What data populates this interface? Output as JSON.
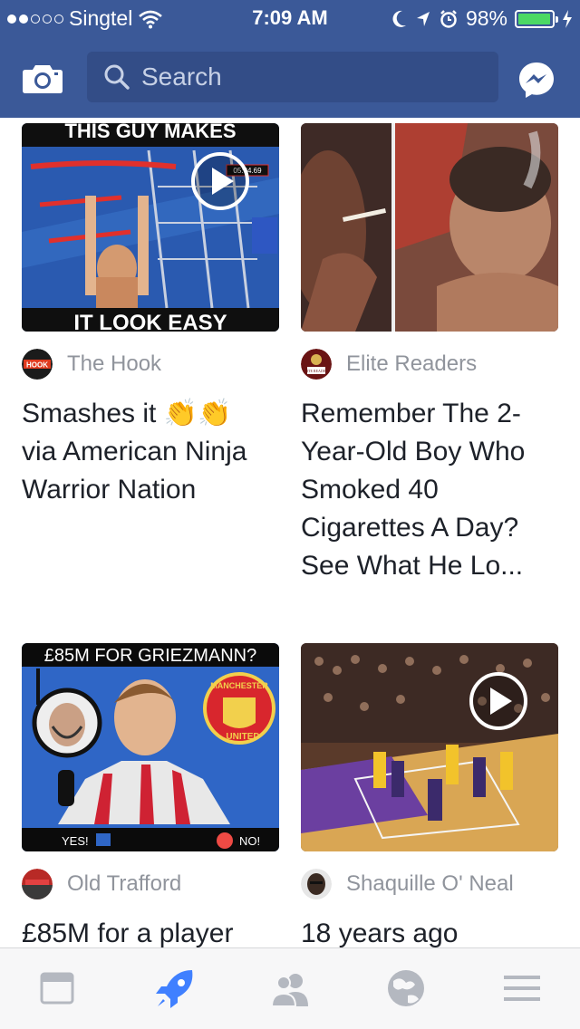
{
  "status": {
    "carrier": "Singtel",
    "time": "7:09 AM",
    "battery": "98%",
    "signal_bars": 2,
    "signal_total": 5,
    "battery_level": 0.98
  },
  "navbar": {
    "search_placeholder": "Search",
    "camera_icon": "camera-icon",
    "messenger_icon": "messenger-icon"
  },
  "cards": [
    {
      "thumb_text_top": "THIS GUY MAKES",
      "thumb_text_bottom": "IT LOOK EASY",
      "timer": "05:04.69",
      "source": "The Hook",
      "source_avatar_text": "HOOK",
      "title_line1": "Smashes it 👏👏",
      "title_line2": "via American Ninja",
      "title_line3": "Warrior Nation",
      "has_video": true
    },
    {
      "source": "Elite Readers",
      "source_avatar_text": "ELITE READERS",
      "title_line1": "Remember The 2-",
      "title_line2": "Year-Old Boy Who",
      "title_line3": "Smoked 40",
      "title_line4": "Cigarettes A Day?",
      "title_line5": "See What He Lo...",
      "has_video": false
    },
    {
      "thumb_text_top": "£85M FOR GRIEZMANN?",
      "yes_label": "YES!",
      "no_label": "NO!",
      "badge_text_top": "MANCHESTER",
      "badge_text_bottom": "UNITED",
      "source": "Old Trafford",
      "title_line1": "£85M for a player",
      "has_video": false
    },
    {
      "source": "Shaquille O' Neal",
      "title_line1": "18 years ago",
      "has_video": true
    }
  ],
  "tabs": [
    {
      "name": "news-feed-icon",
      "active": false
    },
    {
      "name": "explore-rocket-icon",
      "active": true
    },
    {
      "name": "friends-icon",
      "active": false
    },
    {
      "name": "globe-icon",
      "active": false
    },
    {
      "name": "menu-icon",
      "active": false
    }
  ],
  "colors": {
    "brand": "#3b5998",
    "active_tab": "#4080ff",
    "inactive_tab": "#b4b8c0",
    "battery": "#4cd964"
  }
}
